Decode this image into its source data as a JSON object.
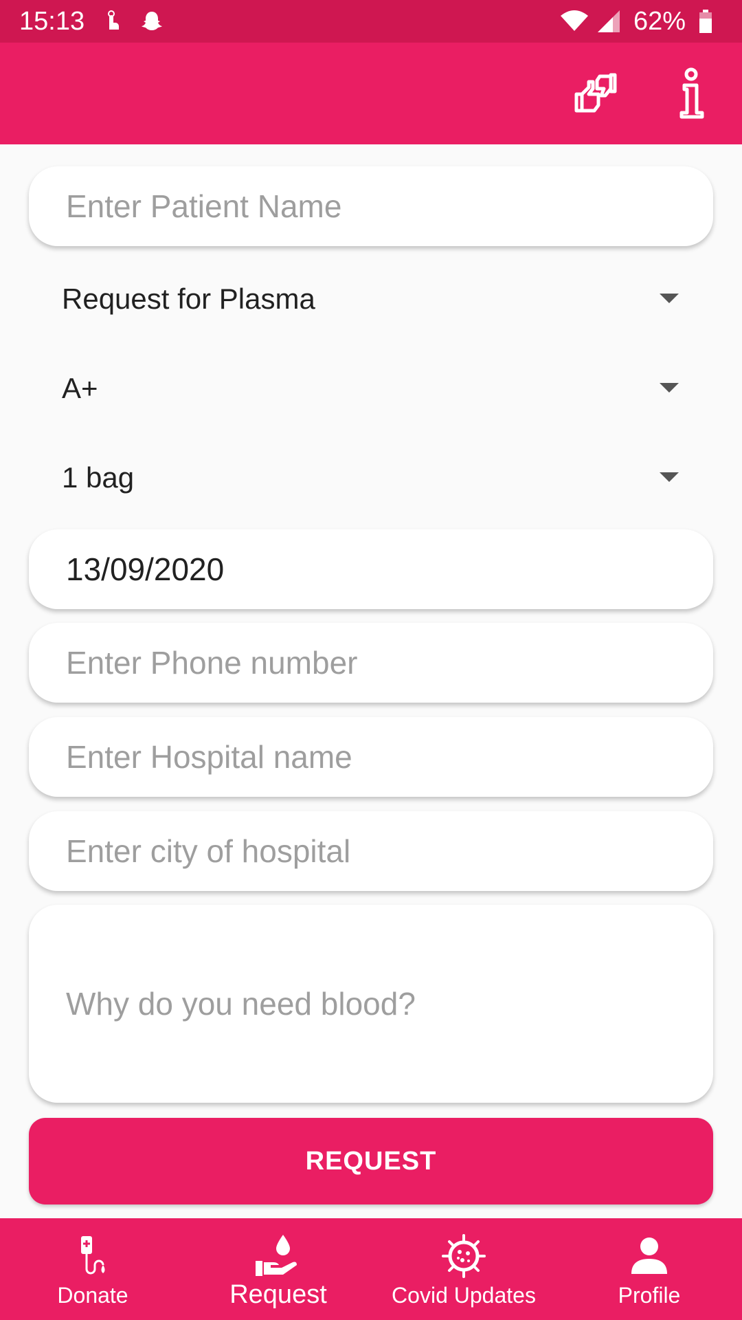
{
  "status_bar": {
    "time": "15:13",
    "battery": "62%"
  },
  "form": {
    "patient_name_placeholder": "Enter Patient Name",
    "request_type": "Request for Plasma",
    "blood_group": "A+",
    "quantity": "1 bag",
    "date": "13/09/2020",
    "phone_placeholder": "Enter Phone number",
    "hospital_placeholder": "Enter Hospital name",
    "city_placeholder": "Enter city of hospital",
    "reason_placeholder": "Why do you need blood?",
    "submit_label": "REQUEST"
  },
  "bottom_nav": {
    "items": [
      {
        "label": "Donate",
        "icon": "iv-drip-icon"
      },
      {
        "label": "Request",
        "icon": "hand-drop-icon"
      },
      {
        "label": "Covid Updates",
        "icon": "virus-icon"
      },
      {
        "label": "Profile",
        "icon": "person-icon"
      }
    ],
    "active_index": 1
  },
  "colors": {
    "primary": "#ea1e63",
    "status_bar": "#cf1751",
    "background": "#fafafa"
  }
}
